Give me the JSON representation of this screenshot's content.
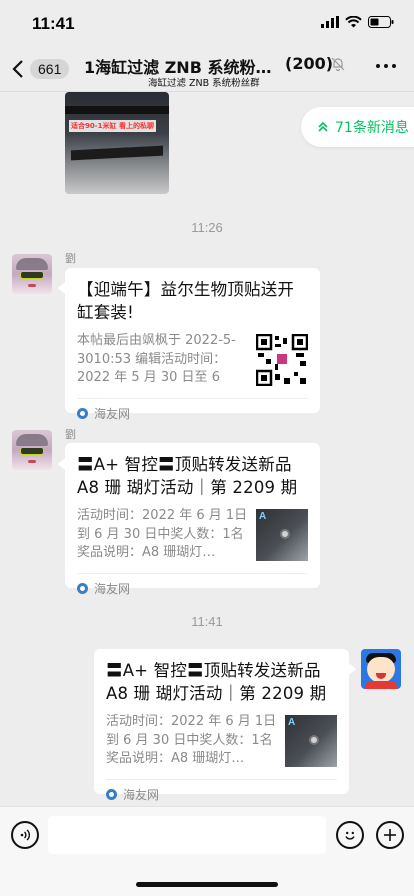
{
  "status_bar": {
    "time": "11:41"
  },
  "nav": {
    "back_badge": "661",
    "title": "1海缸过滤 ZNB 系统粉…",
    "member_count": "(200)",
    "subtitle": "海缸过滤 ZNB 系统粉丝群"
  },
  "new_messages_pill": {
    "label": "71条新消息"
  },
  "prev_image": {
    "caption": "适合90-1米缸 看上的私聊"
  },
  "timestamps": [
    "11:26",
    "11:41"
  ],
  "messages": [
    {
      "sender": "劉",
      "title": "【迎端午】益尔生物顶贴送开缸套装!",
      "desc": "本帖最后由飒枫于 2022-5-3010:53 编辑活动时间：2022 年 5 月 30 日至 6 月…",
      "source": "海友网"
    },
    {
      "sender": "劉",
      "title": "〓A+ 智控〓顶贴转发送新品A8 珊 瑚灯活动｜第 2209 期｜",
      "desc": "活动时间：2022 年 6 月 1日到 6 月 30 日中奖人数：1名奖品说明：A8 珊瑚灯…",
      "thumb_logo": "A",
      "source": "海友网"
    },
    {
      "sender": "",
      "title": "〓A+ 智控〓顶贴转发送新品A8 珊 瑚灯活动｜第 2209 期｜",
      "desc": "活动时间：2022 年 6 月 1日到 6 月 30 日中奖人数：1名奖品说明：A8 珊瑚灯…",
      "thumb_logo": "A",
      "source": "海友网"
    }
  ],
  "colors": {
    "accent_green": "#07c160",
    "chat_bg": "#ededed"
  }
}
